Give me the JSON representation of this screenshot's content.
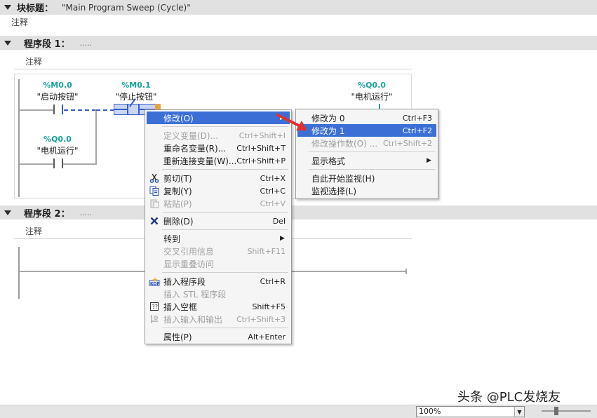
{
  "block": {
    "title_label": "块标题：",
    "title_value": "\"Main Program Sweep (Cycle)\"",
    "comment": "注释"
  },
  "network1": {
    "label": "程序段 1：",
    "title": ".....",
    "comment": "注释",
    "ops": [
      {
        "addr": "%M0.0",
        "name": "\"启动按钮\""
      },
      {
        "addr": "%M0.1",
        "name": "\"停止按钮\""
      },
      {
        "addr": "%Q0.0",
        "name": "\"电机运行\""
      },
      {
        "addr": "%Q0.0",
        "name": "\"电机运行\""
      }
    ]
  },
  "network2": {
    "label": "程序段 2：",
    "title": ".....",
    "comment": "注释"
  },
  "context_menu": {
    "items": [
      {
        "label": "修改(O)",
        "shortcut": "",
        "state": "highlight",
        "submenu": true
      },
      {
        "label": "定义变量(D)...",
        "shortcut": "Ctrl+Shift+I",
        "state": "disabled"
      },
      {
        "label": "重命名变量(R)...",
        "shortcut": "Ctrl+Shift+T",
        "state": "enabled"
      },
      {
        "label": "重新连接变量(W)...",
        "shortcut": "Ctrl+Shift+P",
        "state": "enabled"
      },
      {
        "label": "剪切(T)",
        "shortcut": "Ctrl+X",
        "state": "enabled",
        "icon": "scissors-icon"
      },
      {
        "label": "复制(Y)",
        "shortcut": "Ctrl+C",
        "state": "enabled",
        "icon": "copy-icon"
      },
      {
        "label": "粘贴(P)",
        "shortcut": "Ctrl+V",
        "state": "disabled",
        "icon": "paste-icon"
      },
      {
        "label": "删除(D)",
        "shortcut": "Del",
        "state": "enabled",
        "icon": "delete-icon"
      },
      {
        "label": "转到",
        "shortcut": "",
        "state": "enabled",
        "submenu": true
      },
      {
        "label": "交叉引用信息",
        "shortcut": "Shift+F11",
        "state": "disabled"
      },
      {
        "label": "显示重叠访问",
        "shortcut": "",
        "state": "disabled"
      },
      {
        "label": "插入程序段",
        "shortcut": "Ctrl+R",
        "state": "enabled",
        "icon": "insert-network-icon"
      },
      {
        "label": "插入 STL 程序段",
        "shortcut": "",
        "state": "disabled"
      },
      {
        "label": "插入空框",
        "shortcut": "Shift+F5",
        "state": "enabled",
        "icon": "empty-box-icon"
      },
      {
        "label": "插入输入和输出",
        "shortcut": "Ctrl+Shift+3",
        "state": "disabled",
        "icon": "insert-io-icon"
      },
      {
        "label": "属性(P)",
        "shortcut": "Alt+Enter",
        "state": "enabled"
      }
    ]
  },
  "submenu": {
    "items": [
      {
        "label": "修改为 0",
        "shortcut": "Ctrl+F3",
        "state": "enabled"
      },
      {
        "label": "修改为 1",
        "shortcut": "Ctrl+F2",
        "state": "highlight"
      },
      {
        "label": "修改操作数(O) ...",
        "shortcut": "Ctrl+Shift+2",
        "state": "disabled"
      },
      {
        "label": "显示格式",
        "shortcut": "",
        "state": "enabled",
        "submenu": true
      },
      {
        "label": "自此开始监视(H)",
        "shortcut": "",
        "state": "enabled"
      },
      {
        "label": "监视选择(L)",
        "shortcut": "",
        "state": "enabled"
      }
    ]
  },
  "status": {
    "zoom": "100%"
  },
  "watermark": {
    "text": "头条 @PLC发烧友"
  },
  "colors": {
    "highlight": "#3c6fd6",
    "operand": "#1aa39a",
    "arrow": "#e03030"
  }
}
